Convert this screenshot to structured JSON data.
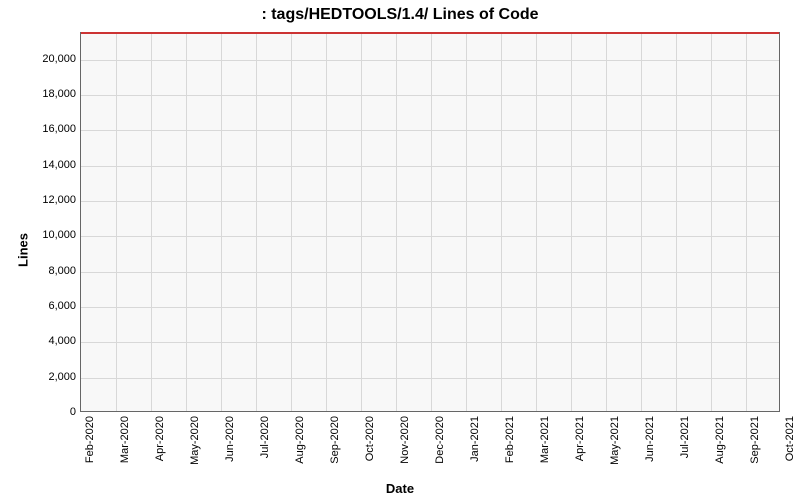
{
  "chart_data": {
    "type": "line",
    "title": ": tags/HEDTOOLS/1.4/ Lines of Code",
    "xlabel": "Date",
    "ylabel": "Lines",
    "ylim": [
      0,
      21500
    ],
    "y_ticks": [
      0,
      2000,
      4000,
      6000,
      8000,
      10000,
      12000,
      14000,
      16000,
      18000,
      20000
    ],
    "y_tick_labels": [
      "0",
      "2,000",
      "4,000",
      "6,000",
      "8,000",
      "10,000",
      "12,000",
      "14,000",
      "16,000",
      "18,000",
      "20,000"
    ],
    "categories": [
      "Feb-2020",
      "Mar-2020",
      "Apr-2020",
      "May-2020",
      "Jun-2020",
      "Jul-2020",
      "Aug-2020",
      "Sep-2020",
      "Oct-2020",
      "Nov-2020",
      "Dec-2020",
      "Jan-2021",
      "Feb-2021",
      "Mar-2021",
      "Apr-2021",
      "May-2021",
      "Jun-2021",
      "Jul-2021",
      "Aug-2021",
      "Sep-2021",
      "Oct-2021"
    ],
    "series": [
      {
        "name": "Lines of Code",
        "color": "#cc3333",
        "values": [
          21500,
          21500,
          21500,
          21500,
          21500,
          21500,
          21500,
          21500,
          21500,
          21500,
          21500,
          21500,
          21500,
          21500,
          21500,
          21500,
          21500,
          21500,
          21500,
          21500,
          21500
        ]
      }
    ]
  }
}
